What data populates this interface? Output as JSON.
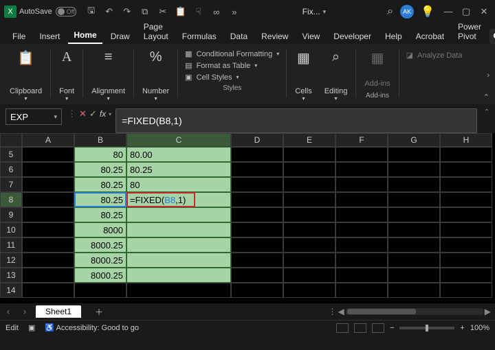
{
  "app_icon_letter": "X",
  "titlebar": {
    "autosave_label": "AutoSave",
    "autosave_state": "Off",
    "doc_title": "Fix...",
    "avatar": "AK"
  },
  "menu": {
    "tabs": [
      "File",
      "Insert",
      "Home",
      "Draw",
      "Page Layout",
      "Formulas",
      "Data",
      "Review",
      "View",
      "Developer",
      "Help",
      "Acrobat",
      "Power Pivot"
    ],
    "active": "Home"
  },
  "ribbon": {
    "clipboard": "Clipboard",
    "font": "Font",
    "alignment": "Alignment",
    "number": "Number",
    "styles": {
      "cond_fmt": "Conditional Formatting",
      "as_table": "Format as Table",
      "cell_styles": "Cell Styles",
      "group_label": "Styles"
    },
    "cells": "Cells",
    "editing": "Editing",
    "addins": "Add-ins",
    "addins_group": "Add-ins",
    "analyze": "Analyze Data"
  },
  "formula_bar": {
    "name_box": "EXP",
    "formula_text": "=FIXED(B8,1)"
  },
  "grid": {
    "columns": [
      "A",
      "B",
      "C",
      "D",
      "E",
      "F",
      "G",
      "H"
    ],
    "active_col": "C",
    "active_row": "8",
    "rows": [
      {
        "n": "5",
        "b": "80",
        "c": "80.00"
      },
      {
        "n": "6",
        "b": "80.25",
        "c": "80.25"
      },
      {
        "n": "7",
        "b": "80.25",
        "c": "80"
      },
      {
        "n": "8",
        "b": "80.25",
        "c": "=FIXED(B8,1)"
      },
      {
        "n": "9",
        "b": "80.25",
        "c": ""
      },
      {
        "n": "10",
        "b": "8000",
        "c": ""
      },
      {
        "n": "11",
        "b": "8000.25",
        "c": ""
      },
      {
        "n": "12",
        "b": "8000.25",
        "c": ""
      },
      {
        "n": "13",
        "b": "8000.25",
        "c": ""
      },
      {
        "n": "14",
        "b": "",
        "c": ""
      }
    ],
    "edit_cell_parts": {
      "pre": "=FIXED(",
      "ref": "B8",
      "post": ",1)"
    }
  },
  "sheets": {
    "current": "Sheet1"
  },
  "status": {
    "mode": "Edit",
    "accessibility": "Accessibility: Good to go",
    "zoom": "100%"
  }
}
